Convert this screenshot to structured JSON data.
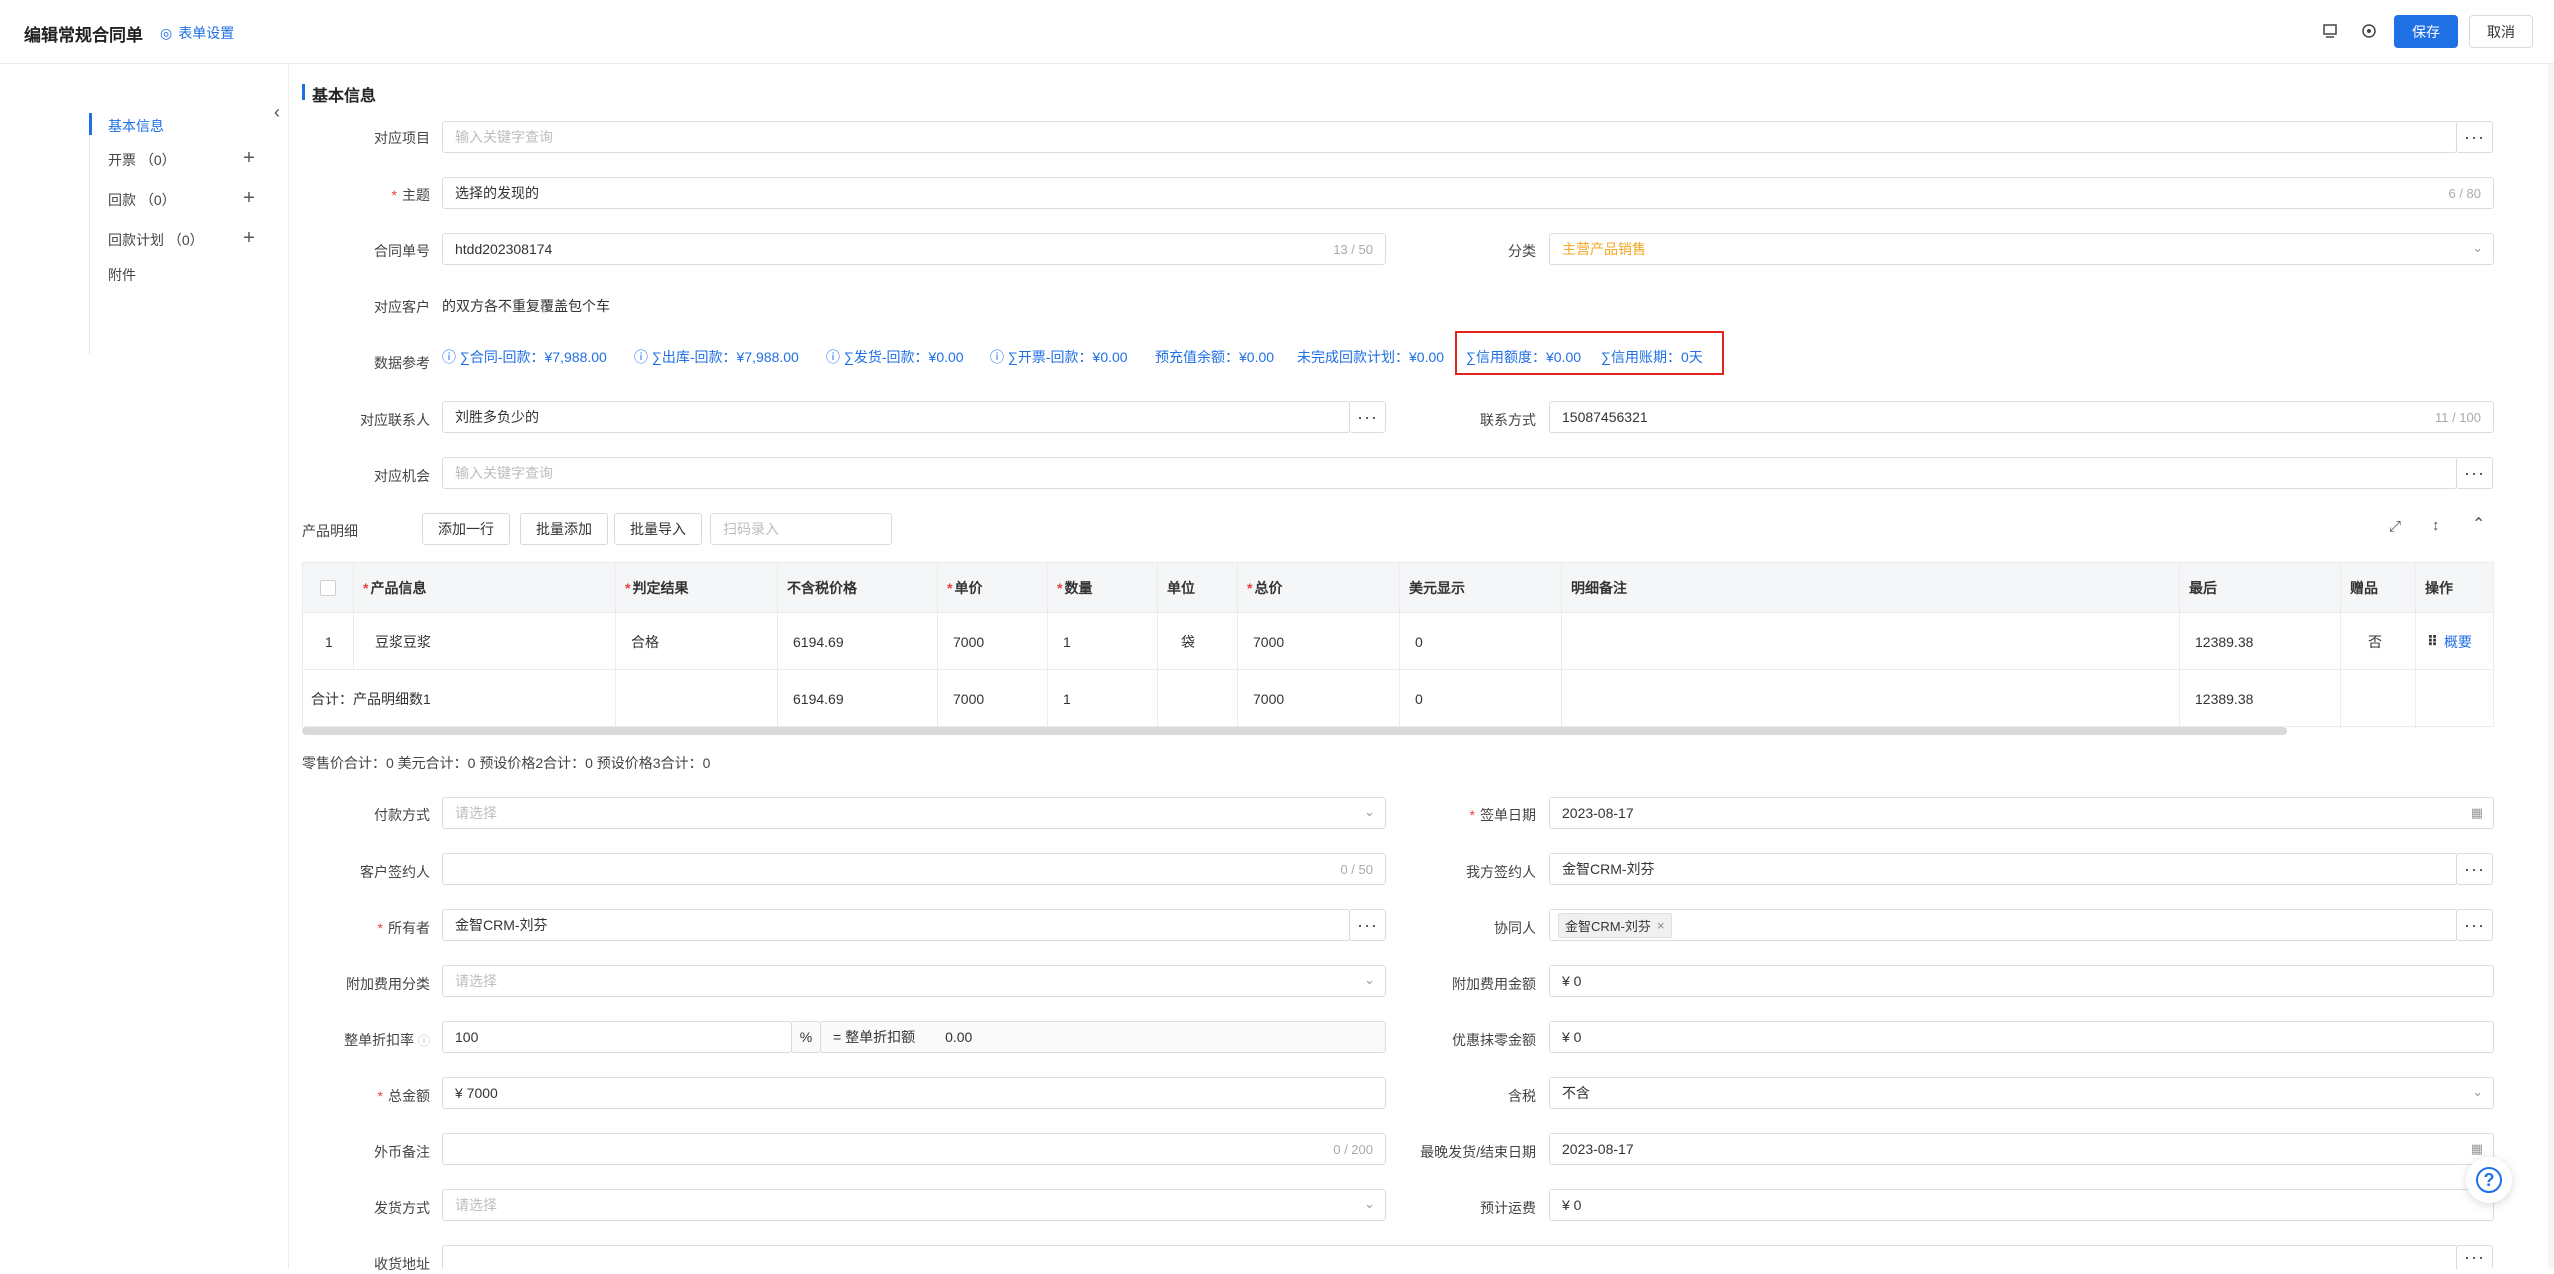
{
  "header": {
    "title": "编辑常规合同单",
    "form_settings": "表单设置",
    "save": "保存",
    "cancel": "取消"
  },
  "sidebar": {
    "items": [
      {
        "label": "基本信息"
      },
      {
        "label": "开票 （0）"
      },
      {
        "label": "回款 （0）"
      },
      {
        "label": "回款计划 （0）"
      },
      {
        "label": "附件"
      }
    ]
  },
  "section": {
    "title": "基本信息"
  },
  "form": {
    "project": {
      "label": "对应项目",
      "placeholder": "输入关键字查询"
    },
    "subject": {
      "label": "主题",
      "value": "选择的发现的",
      "count": "6 / 80"
    },
    "contract_no": {
      "label": "合同单号",
      "value": "htdd202308174",
      "count": "13 / 50"
    },
    "category": {
      "label": "分类",
      "value": "主营产品销售"
    },
    "customer": {
      "label": "对应客户",
      "value": "的双方各不重复覆盖包个车"
    },
    "data_ref": {
      "label": "数据参考",
      "items": [
        "∑合同-回款：¥7,988.00",
        "∑出库-回款：¥7,988.00",
        "∑发货-回款：¥0.00",
        "∑开票-回款：¥0.00",
        "预充值余额：¥0.00",
        "未完成回款计划：¥0.00",
        "∑信用额度：¥0.00",
        "∑信用账期：0天"
      ]
    },
    "contact": {
      "label": "对应联系人",
      "value": "刘胜多负少的"
    },
    "contact_method": {
      "label": "联系方式",
      "value": "15087456321",
      "count": "11 / 100"
    },
    "opportunity": {
      "label": "对应机会",
      "placeholder": "输入关键字查询"
    }
  },
  "products": {
    "label": "产品明细",
    "add_row": "添加一行",
    "batch_add": "批量添加",
    "batch_import": "批量导入",
    "scan_placeholder": "扫码录入",
    "columns": [
      "产品信息",
      "判定结果",
      "不含税价格",
      "单价",
      "数量",
      "单位",
      "总价",
      "美元显示",
      "明细备注",
      "最后",
      "赠品",
      "操作"
    ],
    "rows": [
      {
        "index": "1",
        "product": "豆浆豆浆",
        "result": "合格",
        "price_ex_tax": "6194.69",
        "unit_price": "7000",
        "qty": "1",
        "unit": "袋",
        "total": "7000",
        "usd": "0",
        "remark": "",
        "last": "12389.38",
        "gift": "否",
        "action": "概要"
      }
    ],
    "summary": {
      "label": "合计：产品明细数1",
      "price_ex_tax": "6194.69",
      "unit_price": "7000",
      "qty": "1",
      "total": "7000",
      "usd": "0",
      "last": "12389.38"
    },
    "totals_line": "零售价合计：0 美元合计：0 预设价格2合计：0 预设价格3合计：0"
  },
  "form2": {
    "payment": {
      "label": "付款方式",
      "placeholder": "请选择"
    },
    "sign_date": {
      "label": "签单日期",
      "value": "2023-08-17"
    },
    "customer_signer": {
      "label": "客户签约人",
      "count": "0 / 50"
    },
    "our_signer": {
      "label": "我方签约人",
      "value": "金智CRM-刘芬"
    },
    "owner": {
      "label": "所有者",
      "value": "金智CRM-刘芬"
    },
    "collaborator": {
      "label": "协同人",
      "tag": "金智CRM-刘芬"
    },
    "extra_fee_cat": {
      "label": "附加费用分类",
      "placeholder": "请选择"
    },
    "extra_fee_amt": {
      "label": "附加费用金额",
      "value": "¥ 0"
    },
    "discount_rate": {
      "label": "整单折扣率",
      "value": "100",
      "unit": "%",
      "eq_label": "= 整单折扣额",
      "eq_value": "0.00"
    },
    "rounding": {
      "label": "优惠抹零金额",
      "value": "¥ 0"
    },
    "total_amt": {
      "label": "总金额",
      "value": "¥ 7000"
    },
    "tax": {
      "label": "含税",
      "value": "不含"
    },
    "fx_remark": {
      "label": "外币备注",
      "count": "0 / 200"
    },
    "last_ship_date": {
      "label": "最晚发货/结束日期",
      "value": "2023-08-17"
    },
    "ship_method": {
      "label": "发货方式",
      "placeholder": "请选择"
    },
    "est_freight": {
      "label": "预计运费",
      "value": "¥ 0"
    },
    "address": {
      "label": "收货地址"
    }
  },
  "colors": {
    "accent": "#1f6fe5",
    "required": "#e8403a",
    "category_text": "#f5a623",
    "highlight": "#e2231a"
  }
}
